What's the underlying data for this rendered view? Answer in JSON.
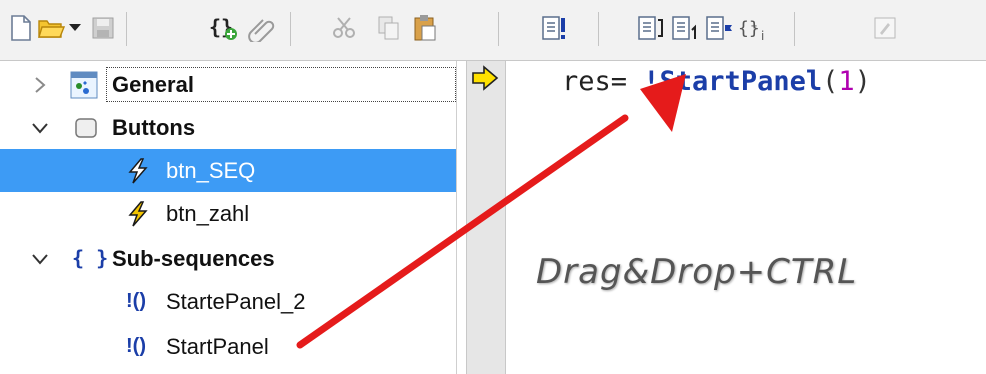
{
  "toolbar": {
    "buttons": [
      {
        "name": "new-file",
        "icon": "new-document-icon"
      },
      {
        "name": "open-file",
        "icon": "folder-open-icon"
      },
      {
        "name": "save",
        "icon": "save-disk-icon"
      },
      {
        "name": "add-subsequence",
        "icon": "braces-add-icon"
      },
      {
        "name": "link",
        "icon": "paperclip-icon"
      },
      {
        "name": "cut",
        "icon": "scissors-icon"
      },
      {
        "name": "copy",
        "icon": "copy-icon"
      },
      {
        "name": "paste",
        "icon": "clipboard-icon"
      },
      {
        "name": "check",
        "icon": "doc-exclamation-icon"
      },
      {
        "name": "insert-line",
        "icon": "doc-lines-icon"
      },
      {
        "name": "insert-number",
        "icon": "doc-number-icon"
      },
      {
        "name": "insert-flag",
        "icon": "doc-flag-icon"
      },
      {
        "name": "insert-index",
        "icon": "braces-index-icon"
      },
      {
        "name": "edit",
        "icon": "edit-disabled-icon"
      }
    ]
  },
  "tree": {
    "items": [
      {
        "label": "General",
        "expanded": false,
        "bold": true,
        "icon": "panel-icon"
      },
      {
        "label": "Buttons",
        "expanded": true,
        "bold": true,
        "icon": "button-icon"
      },
      {
        "label": "btn_SEQ",
        "selected": true,
        "icon": "lightning-icon"
      },
      {
        "label": "btn_zahl",
        "icon": "lightning-icon"
      },
      {
        "label": "Sub-sequences",
        "expanded": true,
        "bold": true,
        "icon": "braces-icon"
      },
      {
        "label": "StartePanel_2",
        "icon": "subseq-call-icon"
      },
      {
        "label": "StartPanel",
        "icon": "subseq-call-icon"
      }
    ],
    "subseq_glyph": "!()",
    "braces_glyph": "{ }"
  },
  "editor": {
    "code": {
      "var": "res= ",
      "call": "!StartPanel",
      "open": "(",
      "arg": "1",
      "close": ")"
    }
  },
  "annotation": {
    "caption": "Drag&Drop+CTRL",
    "arrow_color": "#e51b1b"
  },
  "colors": {
    "selection": "#3d9bf5",
    "call_keyword": "#1b3ea8",
    "number": "#b000b0"
  }
}
